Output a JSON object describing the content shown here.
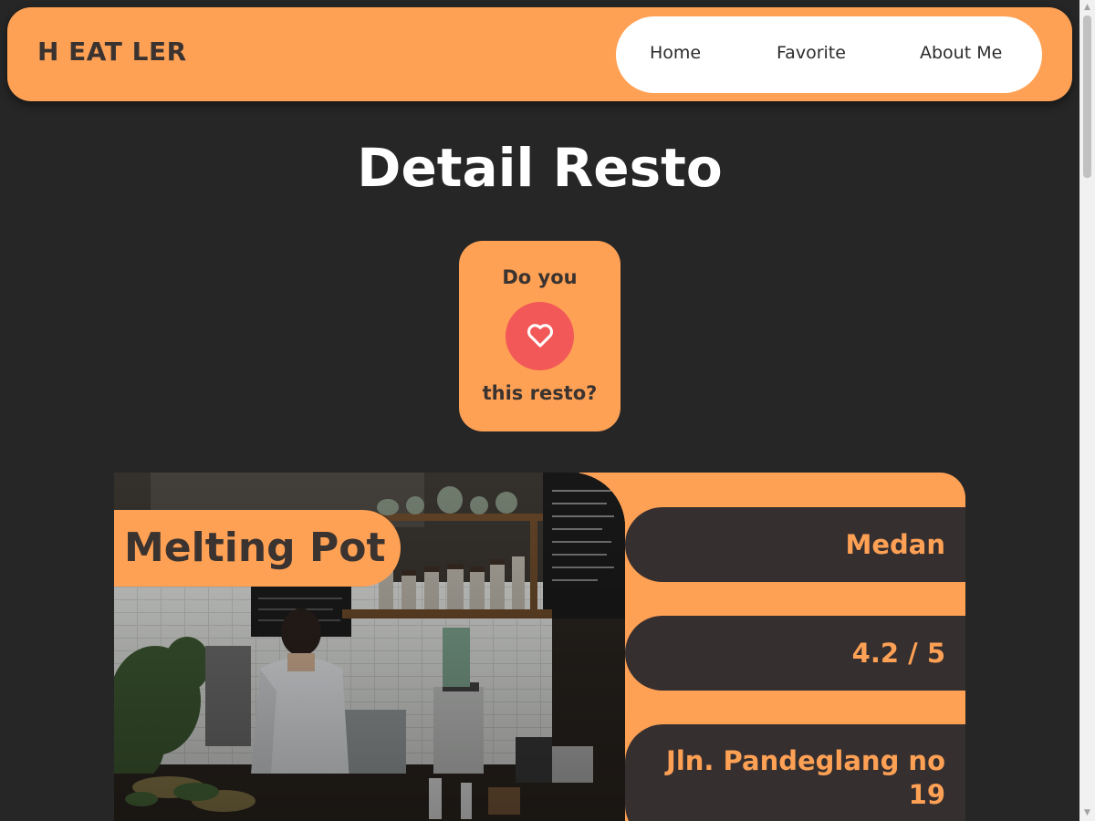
{
  "header": {
    "brand": "H EAT LER",
    "nav": [
      "Home",
      "Favorite",
      "About Me"
    ]
  },
  "main": {
    "title": "Detail Resto",
    "like_prompt": {
      "line1": "Do you",
      "line2": "this resto?",
      "icon": "heart-icon"
    },
    "restaurant": {
      "name": "Melting Pot",
      "city": "Medan",
      "rating": "4.2 / 5",
      "address": "Jln. Pandeglang no 19",
      "image": "cafe-interior-photo"
    }
  },
  "colors": {
    "background": "#262626",
    "accent": "#FFA155",
    "dark_brown": "#362F2F",
    "like_button": "#F25857",
    "text_dark": "#3a3330",
    "white": "#ffffff"
  }
}
